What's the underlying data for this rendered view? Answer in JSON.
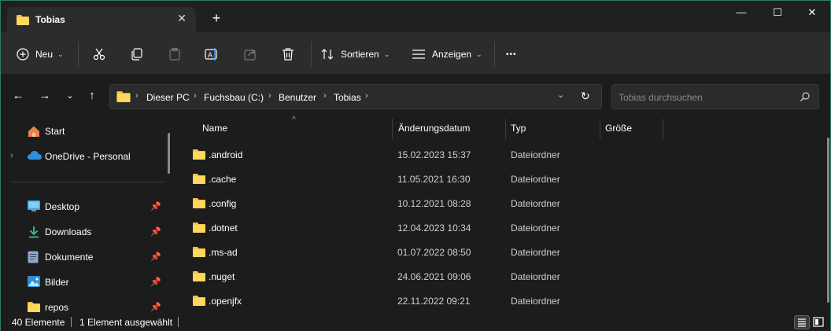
{
  "window": {
    "tab_title": "Tobias",
    "tab_close": "✕",
    "new_tab": "+",
    "controls": {
      "minimize": "—",
      "maximize": "☐",
      "close": "✕"
    },
    "accent": "#2e7d60"
  },
  "toolbar": {
    "new_label": "Neu",
    "sort_label": "Sortieren",
    "view_label": "Anzeigen",
    "more_label": "•••",
    "icons": [
      "add-icon",
      "cut-icon",
      "copy-icon",
      "paste-icon",
      "rename-icon",
      "share-icon",
      "delete-icon",
      "sort-icon",
      "view-icon",
      "more-icon"
    ]
  },
  "address": {
    "crumbs": [
      "Dieser PC",
      "Fuchsbau (C:)",
      "Benutzer",
      "Tobias"
    ],
    "search_placeholder": "Tobias durchsuchen"
  },
  "nav": {
    "items": [
      {
        "label": "Start",
        "icon": "home-icon"
      },
      {
        "label": "OneDrive - Personal",
        "icon": "cloud-icon"
      },
      {
        "label": "Desktop",
        "icon": "desktop-icon"
      },
      {
        "label": "Downloads",
        "icon": "download-icon"
      },
      {
        "label": "Dokumente",
        "icon": "document-icon"
      },
      {
        "label": "Bilder",
        "icon": "picture-icon"
      },
      {
        "label": "repos",
        "icon": "folder-icon"
      }
    ]
  },
  "columns": {
    "name": "Name",
    "date": "Änderungsdatum",
    "type": "Typ",
    "size": "Größe"
  },
  "files": [
    {
      "name": ".android",
      "date": "15.02.2023 15:37",
      "type": "Dateiordner"
    },
    {
      "name": ".cache",
      "date": "11.05.2021 16:30",
      "type": "Dateiordner"
    },
    {
      "name": ".config",
      "date": "10.12.2021 08:28",
      "type": "Dateiordner"
    },
    {
      "name": ".dotnet",
      "date": "12.04.2023 10:34",
      "type": "Dateiordner"
    },
    {
      "name": ".ms-ad",
      "date": "01.07.2022 08:50",
      "type": "Dateiordner"
    },
    {
      "name": ".nuget",
      "date": "24.06.2021 09:06",
      "type": "Dateiordner"
    },
    {
      "name": ".openjfx",
      "date": "22.11.2022 09:21",
      "type": "Dateiordner"
    }
  ],
  "status": {
    "count": "40 Elemente",
    "selected": "1 Element ausgewählt"
  },
  "colors": {
    "folder": "#f4c542",
    "background": "#1c1c1c",
    "toolbar": "#2c2c2c"
  }
}
